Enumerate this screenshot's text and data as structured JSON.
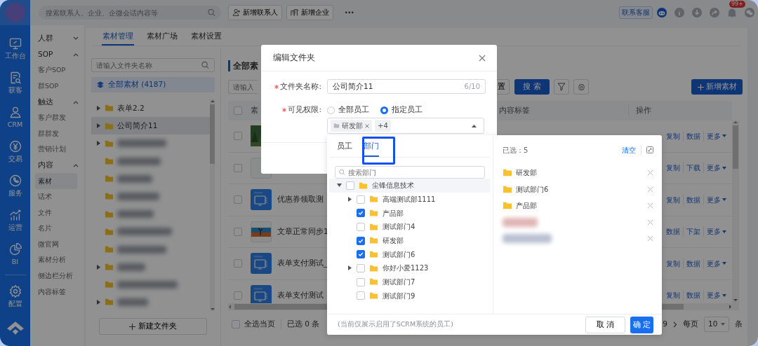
{
  "rail": {
    "items": [
      {
        "label": "工作台"
      },
      {
        "label": "获客"
      },
      {
        "label": "CRM"
      },
      {
        "label": "交易"
      },
      {
        "label": "服务"
      },
      {
        "label": "运营"
      },
      {
        "label": "BI"
      },
      {
        "label": "配置"
      }
    ]
  },
  "top_bar": {
    "search": {
      "placeholder": "搜索联系人、企业、企微会话内容等"
    },
    "buttons": [
      {
        "label": "新增联系人"
      },
      {
        "label": "新增企业"
      }
    ],
    "more": "···",
    "service": "联系客服",
    "notification_badge": "99+"
  },
  "nav": [
    {
      "kind": "group",
      "label": "人群",
      "expanded": false
    },
    {
      "kind": "group",
      "label": "SOP",
      "expanded": true
    },
    {
      "kind": "item",
      "label": "客户SOP",
      "selected": false
    },
    {
      "kind": "item",
      "label": "群SOP",
      "selected": false
    },
    {
      "kind": "group",
      "label": "触达",
      "expanded": true
    },
    {
      "kind": "item",
      "label": "客户群发",
      "selected": false
    },
    {
      "kind": "item",
      "label": "群群发",
      "selected": false
    },
    {
      "kind": "item",
      "label": "营销计划",
      "selected": false
    },
    {
      "kind": "group",
      "label": "内容",
      "expanded": true
    },
    {
      "kind": "item",
      "label": "素材",
      "selected": true
    },
    {
      "kind": "item",
      "label": "话术",
      "selected": false
    },
    {
      "kind": "item",
      "label": "文件",
      "selected": false
    },
    {
      "kind": "item",
      "label": "名片",
      "selected": false
    },
    {
      "kind": "item",
      "label": "微官网",
      "selected": false
    },
    {
      "kind": "item",
      "label": "素材分析",
      "selected": false
    },
    {
      "kind": "item",
      "label": "侧边栏分析",
      "selected": false
    },
    {
      "kind": "item",
      "label": "内容标签",
      "selected": false
    }
  ],
  "tabs": [
    {
      "label": "素材管理",
      "selected": true
    },
    {
      "label": "素材广场",
      "selected": false
    },
    {
      "label": "素材设置",
      "selected": false
    }
  ],
  "folders": {
    "search": {
      "placeholder": "请输入文件夹名称"
    },
    "all": {
      "label": "全部素材 (4187)",
      "selected": true
    },
    "tree": [
      {
        "kind": "folder",
        "label": "表单2.2",
        "expandable": true,
        "highlighted": false
      },
      {
        "kind": "folder",
        "label": "公司简介11",
        "expandable": true,
        "highlighted": true
      },
      {
        "kind": "redacted",
        "expandable": true,
        "highlighted": false
      },
      {
        "kind": "redacted",
        "expandable": false,
        "highlighted": false
      },
      {
        "kind": "redacted",
        "expandable": false,
        "highlighted": false
      },
      {
        "kind": "redacted",
        "expandable": false,
        "highlighted": false
      },
      {
        "kind": "redacted",
        "expandable": false,
        "highlighted": false
      },
      {
        "kind": "redacted",
        "expandable": false,
        "highlighted": false
      },
      {
        "kind": "redacted",
        "expandable": false,
        "highlighted": false
      },
      {
        "kind": "redacted",
        "expandable": true,
        "highlighted": false
      },
      {
        "kind": "redacted",
        "expandable": false,
        "highlighted": false
      },
      {
        "kind": "redacted",
        "expandable": true,
        "highlighted": false
      }
    ],
    "new_folder_button": "新建文件夹"
  },
  "materials": {
    "title": "全部素",
    "header_checkbox": {
      "checked": false
    },
    "search": {
      "placeholder": "请输入"
    },
    "reset_button": "置",
    "search_button": "搜 索",
    "add_button": "新增素材",
    "columns": [
      {
        "label": "素"
      },
      {
        "label": "内容标签"
      },
      {
        "label": "操作"
      }
    ],
    "rows": [
      {
        "checked": false,
        "actions": [
          "复制",
          "数据",
          "更多"
        ]
      },
      {
        "kind": "blank",
        "checked": false,
        "actions": [
          "复制",
          "下载",
          "更多"
        ]
      },
      {
        "kind": "form",
        "title": "优惠券领取测",
        "checked": false,
        "actions": [
          "复制",
          "数据",
          "更多"
        ]
      },
      {
        "kind": "landscape",
        "title": "文章正常同步1",
        "checked": false,
        "actions": [
          "数据",
          "下架",
          "更多"
        ]
      },
      {
        "kind": "form",
        "title": "表单支付测试_",
        "checked": false,
        "actions": [
          "复制",
          "数据",
          "更多"
        ]
      },
      {
        "kind": "form",
        "title": "表单支付测试",
        "checked": false,
        "actions": [
          "复制",
          "数据",
          "更多"
        ]
      }
    ],
    "footer": {
      "select_all": {
        "label": "全选当页",
        "checked": false
      },
      "selected_count": "已选 0 条",
      "page": "9",
      "per_page_label": "每页",
      "per_page": "10",
      "per_page_unit": "条"
    }
  },
  "modal": {
    "title": "编辑文件夹",
    "name_field": {
      "label": "文件夹名称:",
      "required": true,
      "value": "公司简介11",
      "counter": "6/10"
    },
    "visibility": {
      "label": "可见权限:",
      "required": true,
      "options": [
        {
          "label": "全部员工",
          "selected": false
        },
        {
          "label": "指定员工",
          "selected": true
        }
      ],
      "tags": [
        {
          "label": "研发部"
        }
      ],
      "more_count": "+4"
    }
  },
  "picker": {
    "tabs": [
      {
        "label": "员工",
        "selected": false,
        "highlighted": false
      },
      {
        "label": "部门",
        "selected": true,
        "highlighted": true
      }
    ],
    "search": {
      "placeholder": "搜索部门"
    },
    "tree": [
      {
        "label": "尘锋信息技术",
        "checked": false,
        "expanded": true,
        "children": [
          {
            "label": "高端测试部1111",
            "checked": false,
            "expandable": true
          },
          {
            "label": "产品部",
            "checked": true,
            "expandable": false
          },
          {
            "label": "测试部门4",
            "checked": false,
            "expandable": false
          },
          {
            "label": "研发部",
            "checked": true,
            "expandable": false
          },
          {
            "label": "测试部门6",
            "checked": true,
            "expandable": false
          },
          {
            "label": "你好小爱1123",
            "checked": false,
            "expandable": true
          },
          {
            "label": "测试部门7",
            "checked": false,
            "expandable": false
          },
          {
            "label": "测试部门9",
            "checked": false,
            "expandable": false
          }
        ]
      }
    ],
    "selected_count": "已选：5",
    "clear": "清空",
    "selected": [
      {
        "kind": "department",
        "label": "研发部"
      },
      {
        "kind": "department",
        "label": "测试部门6"
      },
      {
        "kind": "department",
        "label": "产品部"
      },
      {
        "kind": "redacted"
      },
      {
        "kind": "redacted"
      }
    ],
    "note": "(当前仅展示启用了SCRM系统的员工)",
    "cancel": "取 消",
    "confirm": "确 定"
  }
}
